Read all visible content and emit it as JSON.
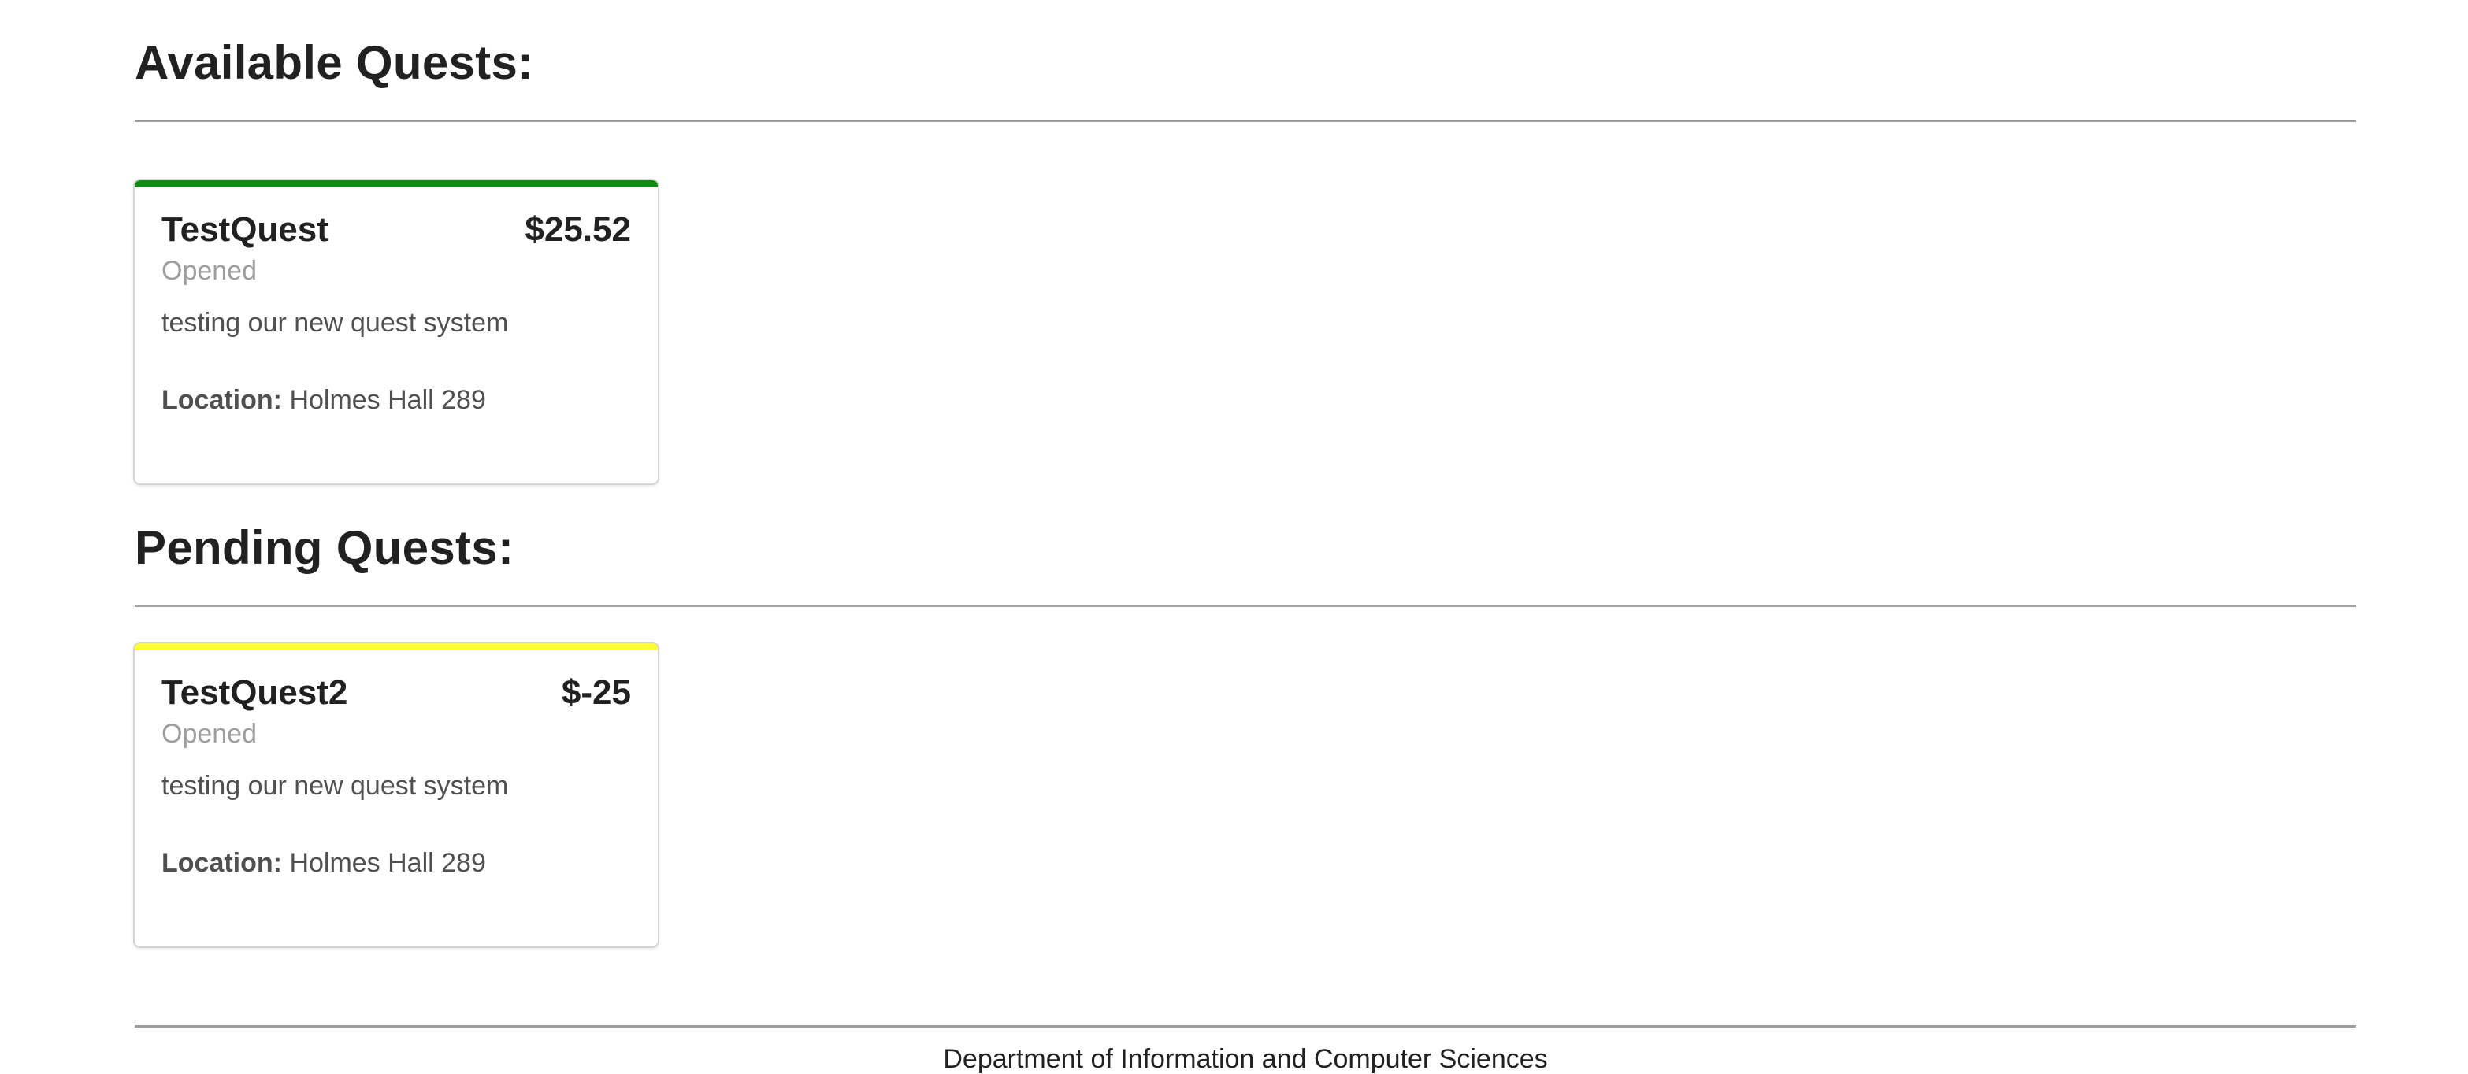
{
  "sections": {
    "available": {
      "title": "Available Quests:",
      "cards": [
        {
          "title": "TestQuest",
          "price": "$25.52",
          "status": "Opened",
          "description": "testing our new quest system",
          "location_label": "Location:",
          "location_value": "Holmes Hall 289",
          "bar_color": "#108a10"
        }
      ]
    },
    "pending": {
      "title": "Pending Quests:",
      "cards": [
        {
          "title": "TestQuest2",
          "price": "$-25",
          "status": "Opened",
          "description": "testing our new quest system",
          "location_label": "Location:",
          "location_value": "Holmes Hall 289",
          "bar_color": "#ffff33"
        }
      ]
    }
  },
  "footer": {
    "text": "Department of Information and Computer Sciences"
  }
}
